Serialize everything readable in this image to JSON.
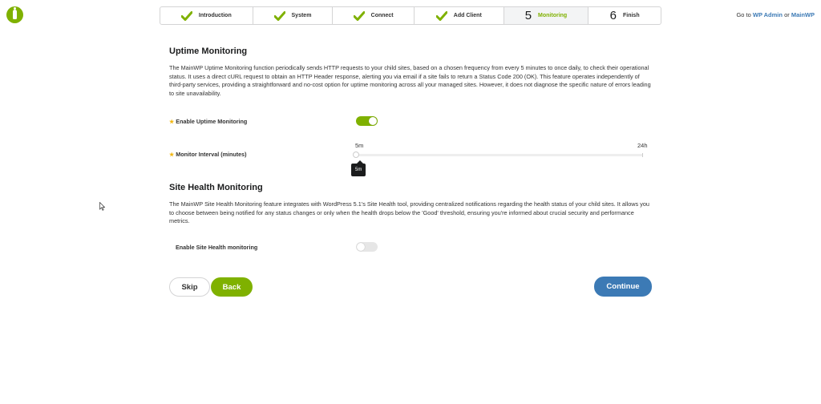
{
  "steps": [
    {
      "label": "Introduction",
      "state": "done",
      "icon": "check-icon"
    },
    {
      "label": "System",
      "state": "done",
      "icon": "check-icon"
    },
    {
      "label": "Connect",
      "state": "done",
      "icon": "check-icon"
    },
    {
      "label": "Add Client",
      "state": "done",
      "icon": "check-icon"
    },
    {
      "number": "5",
      "label": "Monitoring",
      "state": "active"
    },
    {
      "number": "6",
      "label": "Finish",
      "state": "pending"
    }
  ],
  "header_links": {
    "prefix": "Go to",
    "wp_admin": "WP Admin",
    "or": "or",
    "mainwp": "MainWP"
  },
  "uptime": {
    "title": "Uptime Monitoring",
    "description": "The MainWP Uptime Monitoring function periodically sends HTTP requests to your child sites, based on a chosen frequency from every 5 minutes to once daily, to check their operational status. It uses a direct cURL request to obtain an HTTP Header response, alerting you via email if a site fails to return a Status Code 200 (OK). This feature operates independently of third-party services, providing a straightforward and no-cost option for uptime monitoring across all your managed sites. However, it does not diagnose the specific nature of errors leading to site unavailability.",
    "enable_label": "Enable Uptime Monitoring",
    "enable_on": true,
    "interval_label": "Monitor Interval (minutes)",
    "interval_min": "5m",
    "interval_max": "24h",
    "interval_value": "5m",
    "interval_fraction": 0
  },
  "site_health": {
    "title": "Site Health Monitoring",
    "description": "The MainWP Site Health Monitoring feature integrates with WordPress 5.1's Site Health tool, providing centralized notifications regarding the health status of your child sites. It allows you to choose between being notified for any status changes or only when the health drops below the 'Good' threshold, ensuring you're informed about crucial security and performance metrics.",
    "enable_label": "Enable Site Health monitoring",
    "enable_on": false
  },
  "buttons": {
    "skip": "Skip",
    "back": "Back",
    "continue": "Continue"
  },
  "colors": {
    "brand_green": "#7fb100",
    "link_blue": "#3c7ab5",
    "required_star": "#f2b712"
  }
}
